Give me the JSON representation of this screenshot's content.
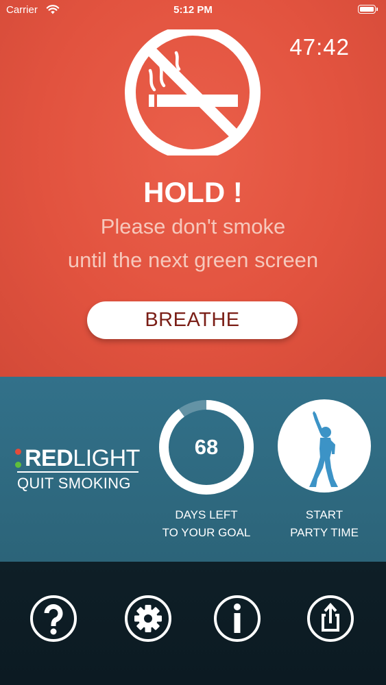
{
  "status_bar": {
    "carrier": "Carrier",
    "time": "5:12 PM"
  },
  "timer": "47:42",
  "alert": {
    "icon": "no-smoking-icon",
    "title": "HOLD !",
    "line1": "Please don't smoke",
    "line2": "until the next green screen"
  },
  "breathe_button": "BREATHE",
  "logo": {
    "bold": "RED",
    "light": "LIGHT",
    "tagline": "QUIT SMOKING"
  },
  "goal": {
    "days_left": "68",
    "progress": 0.9,
    "label_line1": "DAYS LEFT",
    "label_line2": "TO YOUR GOAL"
  },
  "party": {
    "icon": "dancer-icon",
    "label_line1": "START",
    "label_line2": "PARTY TIME"
  },
  "toolbar": {
    "help_icon": "question-icon",
    "settings_icon": "gear-icon",
    "info_icon": "info-icon",
    "share_icon": "share-icon"
  },
  "colors": {
    "alert_red": "#e2533f",
    "panel_teal": "#2f6a81",
    "toolbar_dark": "#0d1c24",
    "dancer_blue": "#3c93c6"
  }
}
